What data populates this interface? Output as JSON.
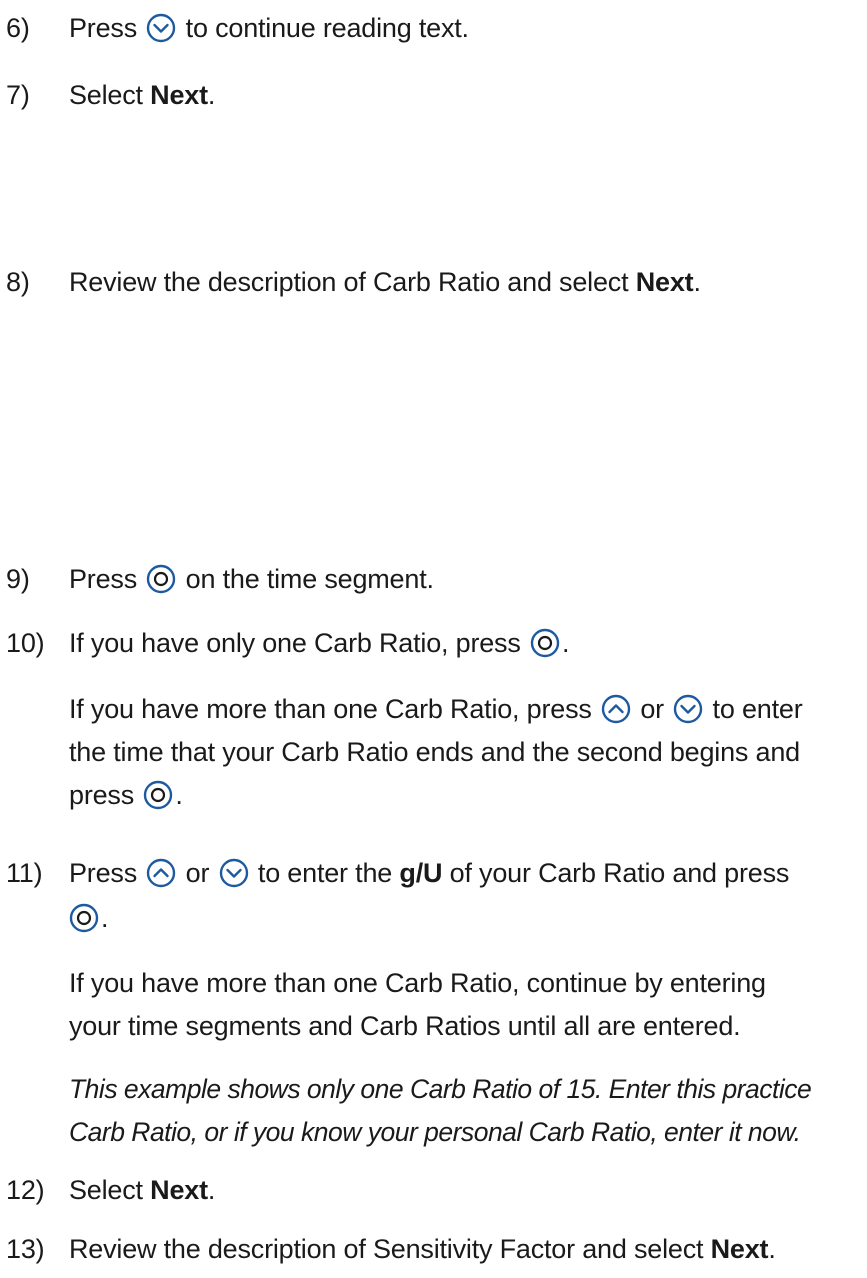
{
  "steps": [
    {
      "num": "6)",
      "parts": [
        "Press",
        "to continue reading text."
      ],
      "icon": "chevron-down-circle-icon"
    },
    {
      "num": "7)",
      "prefix": "Select",
      "bold": "Next",
      "suffix": "."
    },
    {
      "num": "8)",
      "prefix": "Review the description of Carb Ratio and select",
      "bold": "Next",
      "suffix": "."
    },
    {
      "num": "9)",
      "parts": [
        "Press",
        "on the time segment."
      ],
      "icon": "select-circle-icon"
    },
    {
      "num": "10)",
      "parts": [
        "If you have only one Carb Ratio, press",
        "."
      ],
      "icon": "select-circle-icon"
    },
    {
      "num": "11)",
      "parts": [
        "Press",
        "or",
        "to enter the",
        "g/U",
        "of your Carb Ratio and press",
        "."
      ]
    },
    {
      "num": "12)",
      "prefix": "Select",
      "bold": "Next",
      "suffix": "."
    },
    {
      "num": "13)",
      "prefix": "Review the description of Sensitivity Factor and select",
      "bold": "Next",
      "suffix": "."
    }
  ],
  "step10_extra": {
    "line1_a": "If you have more than one Carb Ratio, press",
    "line1_b": "or",
    "line1_c": "to enter",
    "line2": "the time that your Carb Ratio ends and the second begins and",
    "line3_a": "press",
    "line3_b": "."
  },
  "step11_extra": {
    "para1_line1": "If you have more than one Carb Ratio, continue by entering",
    "para1_line2": "your time segments and Carb Ratios until all are entered.",
    "para2_line1": "This example shows only one Carb Ratio of 15. Enter this practice",
    "para2_line2": "Carb Ratio, or if you know your personal Carb Ratio, enter it now."
  },
  "colors": {
    "icon_stroke": "#1e5aa0",
    "text": "#1a1a1a"
  }
}
